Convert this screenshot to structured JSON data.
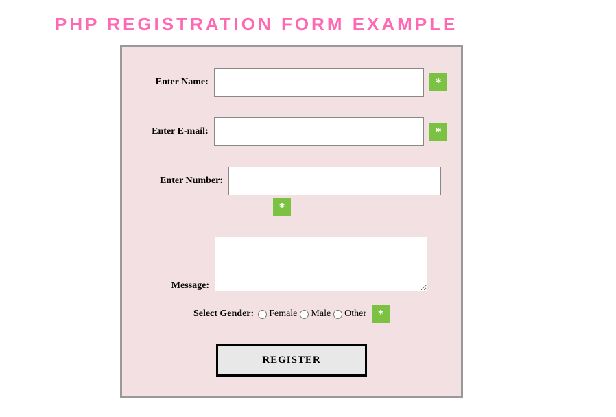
{
  "title": "PHP REGISTRATION FORM EXAMPLE",
  "form": {
    "name": {
      "label": "Enter Name:",
      "value": "",
      "required_marker": "*"
    },
    "email": {
      "label": "Enter E-mail:",
      "value": "",
      "required_marker": "*"
    },
    "number": {
      "label": "Enter Number:",
      "value": "",
      "required_marker": "*"
    },
    "message": {
      "label": "Message:",
      "value": ""
    },
    "gender": {
      "label": "Select Gender:",
      "options": {
        "female": "Female",
        "male": "Male",
        "other": "Other"
      },
      "selected": "",
      "required_marker": "*"
    },
    "submit": {
      "label": "REGISTER"
    }
  }
}
